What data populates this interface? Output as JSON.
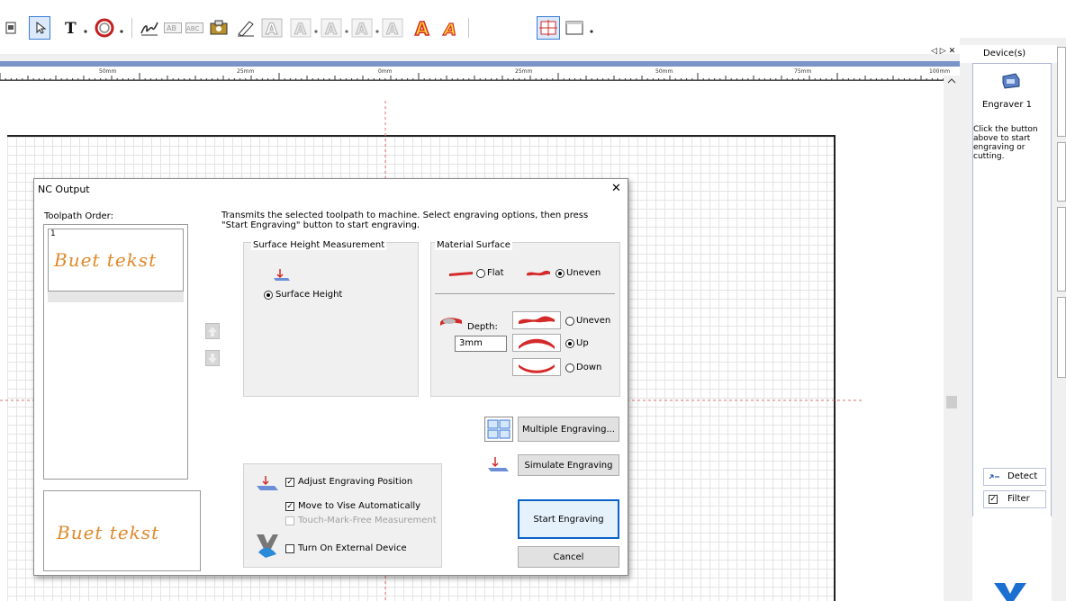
{
  "ruler": {
    "labels": [
      "50mm",
      "25mm",
      "0mm",
      "25mm",
      "50mm",
      "75mm",
      "100mm"
    ]
  },
  "panel": {
    "header_controls": "◁ ▷ ✕",
    "title": "Device(s)",
    "device_name": "Engraver 1",
    "hint": "Click the button above to start engraving or cutting.",
    "detect_label": "Detect",
    "filter_label": "Filter"
  },
  "dialog": {
    "title": "NC Output",
    "close_glyph": "✕",
    "toolpath_order_label": "Toolpath Order:",
    "toolpath_item_number": "1",
    "toolpath_item_text": "Buet tekst",
    "preview_text": "Buet tekst",
    "instructions": "Transmits the selected toolpath to machine.  Select engraving options, then press \"Start Engraving\" button to start engraving.",
    "surface_section_title": "Surface Height Measurement",
    "surface_height_label": "Surface Height",
    "material_section_title": "Material Surface",
    "flat_label": "Flat",
    "uneven_label": "Uneven",
    "material_selected": "Uneven",
    "depth_label": "Depth:",
    "depth_value": "3mm",
    "depth_options": [
      "Uneven",
      "Up",
      "Down"
    ],
    "depth_selected": "Up",
    "multiple_engraving_label": "Multiple Engraving...",
    "simulate_engraving_label": "Simulate Engraving",
    "adjust_position_label": "Adjust Engraving Position",
    "adjust_position_checked": true,
    "move_to_vise_label": "Move to Vise Automatically",
    "move_to_vise_checked": true,
    "touch_mark_label": "Touch-Mark-Free Measurement",
    "touch_mark_checked": false,
    "external_device_label": "Turn On External Device",
    "external_device_checked": false,
    "start_label": "Start Engraving",
    "cancel_label": "Cancel"
  },
  "colors": {
    "accent_red": "#d42a2a",
    "selection_blue": "#0a64c8",
    "script_orange": "#e0892a"
  }
}
